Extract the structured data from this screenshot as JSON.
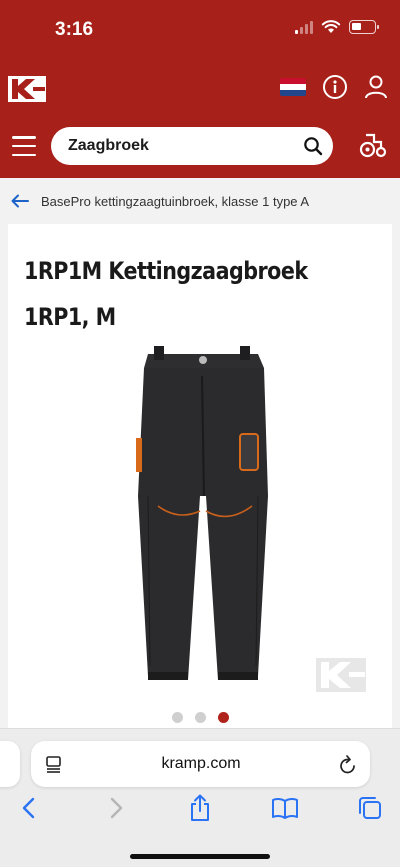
{
  "status_bar": {
    "time": "3:16"
  },
  "header": {
    "brand_colors": {
      "primary": "#a8201a",
      "accent": "#c0261c"
    },
    "logo_icon": "kramp-logo-icon",
    "flag_icon": "netherlands-flag-icon",
    "info_icon": "info-icon",
    "account_icon": "user-icon",
    "search": {
      "value": "Zaagbroek"
    },
    "tractor_icon": "tractor-icon"
  },
  "breadcrumb": {
    "label": "BasePro kettingzaagtuinbroek, klasse 1 type A"
  },
  "product": {
    "title_line1": "1RP1M Kettingzaagbroek",
    "title_line2": "1RP1, M",
    "image_icon": "chainsaw-trousers-image",
    "carousel": {
      "count": 3,
      "active_index": 2
    }
  },
  "safari": {
    "url": "kramp.com",
    "toolbar": [
      "back-icon",
      "forward-icon",
      "share-icon",
      "bookmarks-icon",
      "tabs-icon"
    ]
  }
}
